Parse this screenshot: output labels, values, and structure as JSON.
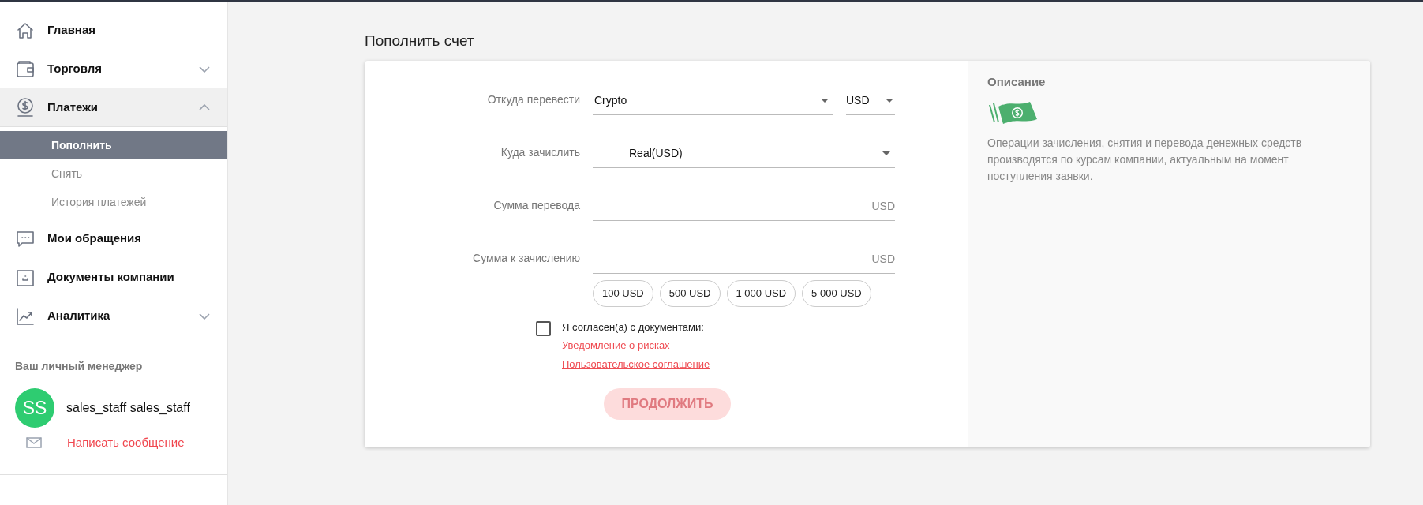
{
  "sidebar": {
    "items": [
      {
        "label": "Главная"
      },
      {
        "label": "Торговля",
        "expanded": false
      },
      {
        "label": "Платежи",
        "expanded": true,
        "children": [
          {
            "label": "Пополнить",
            "selected": true
          },
          {
            "label": "Снять",
            "selected": false
          },
          {
            "label": "История платежей",
            "selected": false
          }
        ]
      },
      {
        "label": "Мои обращения"
      },
      {
        "label": "Документы компании"
      },
      {
        "label": "Аналитика",
        "expanded": false
      }
    ],
    "manager": {
      "heading": "Ваш личный менеджер",
      "initials": "SS",
      "name": "sales_staff sales_staff",
      "message_link": "Написать сообщение"
    }
  },
  "page_title": "Пополнить счет",
  "form": {
    "rows": [
      {
        "kind": "select2",
        "label": "Откуда перевести",
        "value": "Crypto",
        "currency": "USD"
      },
      {
        "kind": "select",
        "label": "Куда зачислить",
        "value": "Real(USD)"
      },
      {
        "kind": "amount",
        "label": "Сумма перевода",
        "suffix": "USD"
      },
      {
        "kind": "amount",
        "label": "Сумма к зачислению",
        "suffix": "USD"
      }
    ],
    "presets": [
      "100 USD",
      "500 USD",
      "1 000 USD",
      "5 000 USD"
    ],
    "agreement": {
      "checked": false,
      "text": "Я согласен(а) с документами:",
      "links": [
        "Уведомление о рисках",
        "Пользовательское соглашение"
      ]
    },
    "submit": {
      "label": "ПРОДОЛЖИТЬ",
      "disabled": true
    }
  },
  "description": {
    "title": "Описание",
    "text": "Операции зачисления, снятия и перевода денежных средств производятся по курсам компании, актуальным на момент поступления заявки."
  }
}
